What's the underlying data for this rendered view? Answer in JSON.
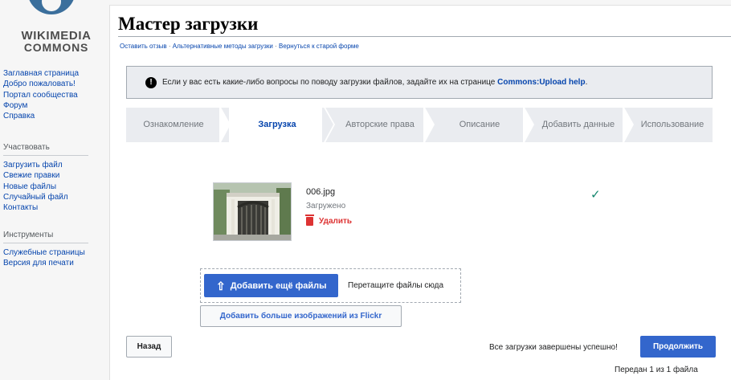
{
  "logo": {
    "line1": "WIKIMEDIA",
    "line2": "COMMONS"
  },
  "sidebar": {
    "main_links": [
      "Заглавная страница",
      "Добро пожаловать!",
      "Портал сообщества",
      "Форум",
      "Справка"
    ],
    "participate_heading": "Участвовать",
    "participate_links": [
      "Загрузить файл",
      "Свежие правки",
      "Новые файлы",
      "Случайный файл",
      "Контакты"
    ],
    "tools_heading": "Инструменты",
    "tools_links": [
      "Служебные страницы",
      "Версия для печати"
    ]
  },
  "page": {
    "title": "Мастер загрузки",
    "links": [
      "Оставить отзыв",
      "Альтернативные методы загрузки",
      "Вернуться к старой форме"
    ],
    "separator": "·"
  },
  "notice": {
    "text": "Если у вас есть какие-либо вопросы по поводу загрузки файлов, задайте их на странице",
    "link": "Commons:Upload help",
    "end": "."
  },
  "steps": [
    "Ознакомление",
    "Загрузка",
    "Авторские права",
    "Описание",
    "Добавить данные",
    "Использование"
  ],
  "active_step": "Загрузка",
  "file": {
    "name": "006.jpg",
    "status": "Загружено",
    "delete_label": "Удалить"
  },
  "upload": {
    "add_more_label": "Добавить ещё файлы",
    "drop_text": "Перетащите файлы сюда",
    "flickr_label": "Добавить больше изображений из Flickr"
  },
  "footer": {
    "back_label": "Назад",
    "done_text": "Все загрузки завершены успешно!",
    "continue_label": "Продолжить",
    "progress_text": "Передан 1 из 1 файла"
  },
  "colors": {
    "accent": "#3366cc",
    "danger": "#dd3333",
    "success": "#14866d",
    "link": "#0645ad"
  }
}
